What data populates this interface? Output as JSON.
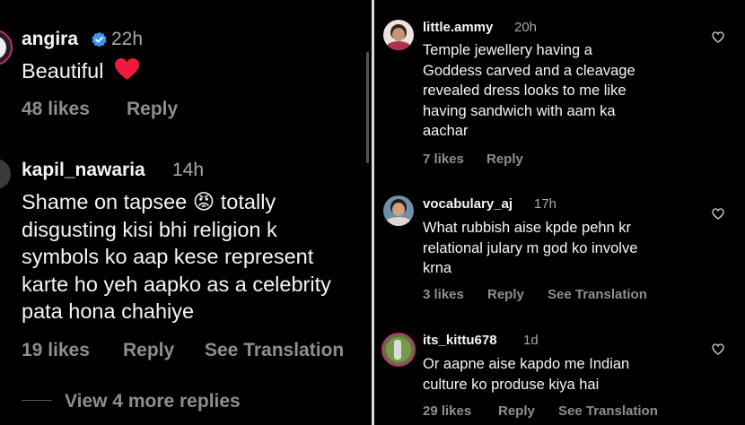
{
  "left": {
    "comments": [
      {
        "username": "angira",
        "verified": true,
        "time": "22h",
        "text": "Beautiful",
        "emoji": "❤️",
        "likes": "48 likes",
        "reply": "Reply"
      },
      {
        "username": "kapil_nawaria",
        "time": "14h",
        "lines": [
          "Shame on tapsee 😡 totally",
          "disgusting  kisi bhi religion k",
          "symbols ko aap kese represent",
          "karte ho yeh aapko as a celebrity",
          "pata hona chahiye"
        ],
        "likes": "19 likes",
        "reply": "Reply",
        "translate": "See Translation"
      }
    ],
    "more_replies": "View 4 more replies"
  },
  "right": {
    "comments": [
      {
        "username": "little.ammy",
        "time": "20h",
        "lines": [
          "Temple jewellery having a",
          "Goddess carved and a cleavage",
          "revealed dress looks to me like",
          "having sandwich with aam ka",
          "aachar"
        ],
        "likes": "7 likes",
        "reply": "Reply"
      },
      {
        "username": "vocabulary_aj",
        "time": "17h",
        "lines": [
          "What rubbish aise kpde pehn kr",
          "relational julary m god ko involve",
          "krna"
        ],
        "likes": "3 likes",
        "reply": "Reply",
        "translate": "See Translation"
      },
      {
        "username": "its_kittu678",
        "time": "1d",
        "lines": [
          "Or aapne aise kapdo me Indian",
          "culture ko produse kiya hai"
        ],
        "likes": "29 likes",
        "reply": "Reply",
        "translate": "See Translation"
      }
    ]
  },
  "icons": {
    "verified": "verified-badge-icon",
    "like": "heart-outline-icon"
  },
  "colors": {
    "background": "#000000",
    "text": "#f5f5f5",
    "muted": "#8e8e8e",
    "verified": "#3897f0",
    "heart": "#ed1c3c"
  }
}
